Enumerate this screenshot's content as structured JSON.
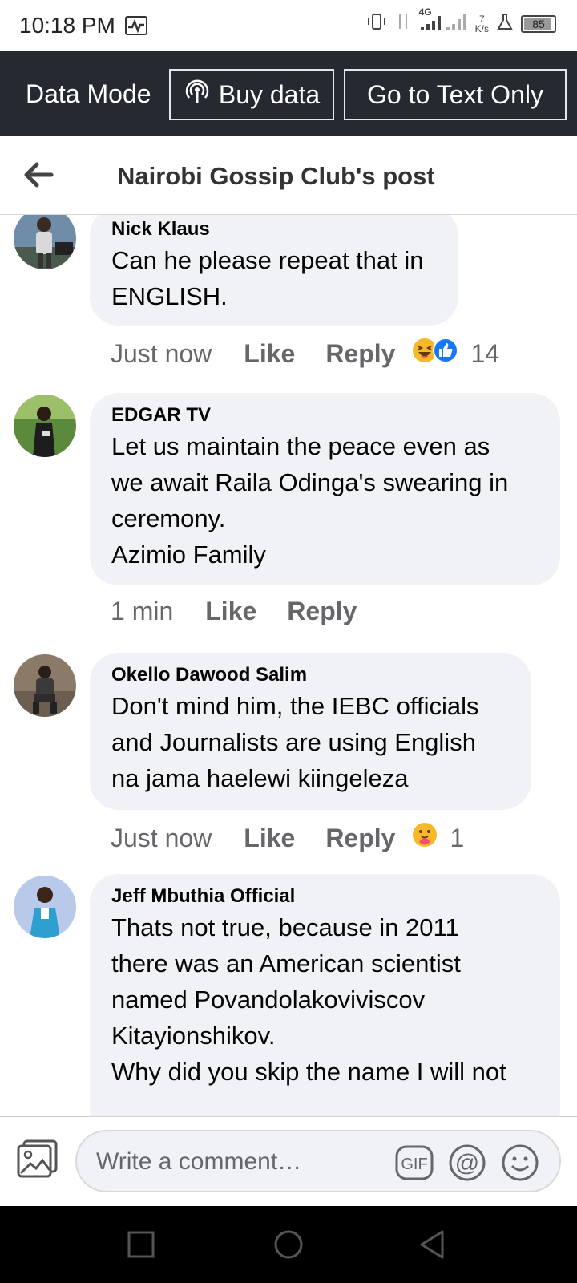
{
  "status_bar": {
    "time": "10:18 PM",
    "network": "4G",
    "speed_value": "7",
    "speed_unit": "K/s",
    "battery": "85"
  },
  "data_bar": {
    "mode_label": "Data Mode",
    "buy_label": "Buy data",
    "text_only_label": "Go to Text Only"
  },
  "header": {
    "title": "Nairobi Gossip Club's post"
  },
  "comments": [
    {
      "name": "Nick Klaus",
      "text": "Can he please repeat that in\nENGLISH.",
      "time": "Just now",
      "like": "Like",
      "reply": "Reply",
      "reactions": [
        "haha-icon",
        "like-icon"
      ],
      "reaction_count": "14"
    },
    {
      "name": "EDGAR TV",
      "text": "Let us maintain the peace even as\nwe await Raila Odinga's swearing in\nceremony.\nAzimio Family",
      "time": "1 min",
      "like": "Like",
      "reply": "Reply"
    },
    {
      "name": "Okello Dawood Salim",
      "text": "Don't mind him, the IEBC officials\nand Journalists are using English\nna jama haelewi kiingeleza",
      "time": "Just now",
      "like": "Like",
      "reply": "Reply",
      "reactions": [
        "care-icon"
      ],
      "reaction_count": "1"
    },
    {
      "name": "Jeff Mbuthia Official",
      "text": "Thats not true, because in 2011\nthere was an American scientist\nnamed Povandolakoviviscov\nKitayionshikov.\nWhy did you skip the name I will not"
    }
  ],
  "composer": {
    "placeholder": "Write a comment…",
    "gif_label": "GIF",
    "mention_label": "@"
  },
  "colors": {
    "data_bar_bg": "#252a31",
    "bubble_bg": "#f0f2f5",
    "meta_text": "#65676b",
    "facebook_blue": "#1877f2"
  }
}
